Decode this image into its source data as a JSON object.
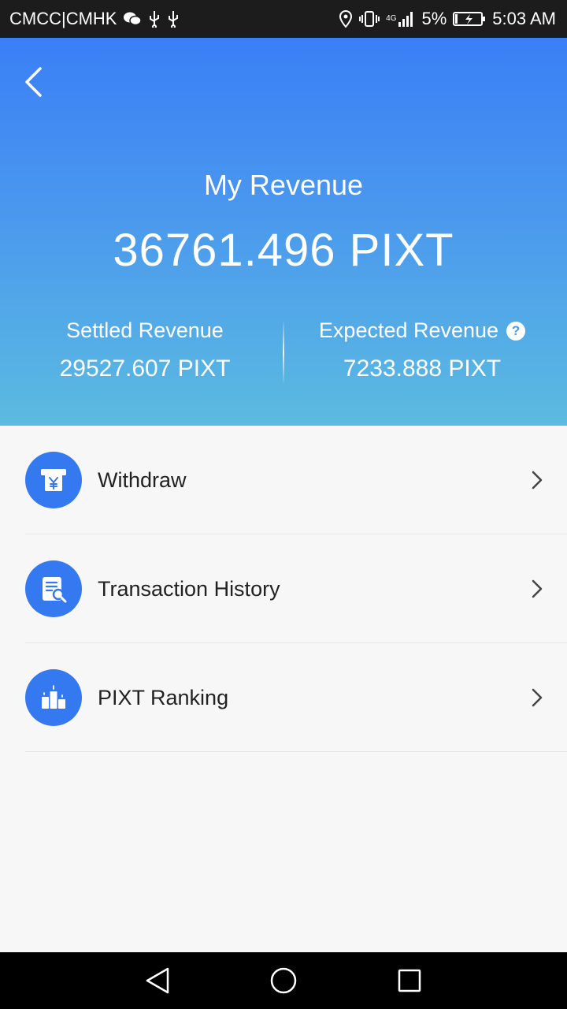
{
  "status_bar": {
    "carrier": "CMCC|CMHK",
    "network": "4G",
    "battery_percent": "5%",
    "time": "5:03 AM"
  },
  "header": {
    "title": "My Revenue",
    "total": "36761.496 PIXT",
    "settled_label": "Settled Revenue",
    "settled_value": "29527.607 PIXT",
    "expected_label": "Expected Revenue",
    "expected_value": "7233.888 PIXT",
    "help_glyph": "?"
  },
  "menu": {
    "items": [
      {
        "label": "Withdraw",
        "icon": "atm-yen-icon"
      },
      {
        "label": "Transaction History",
        "icon": "document-search-icon"
      },
      {
        "label": "PIXT Ranking",
        "icon": "podium-icon"
      }
    ]
  },
  "colors": {
    "header_top": "#3a7ff6",
    "header_bottom": "#5bbbe0",
    "icon_circle": "#3579f0",
    "background": "#f7f7f7"
  }
}
